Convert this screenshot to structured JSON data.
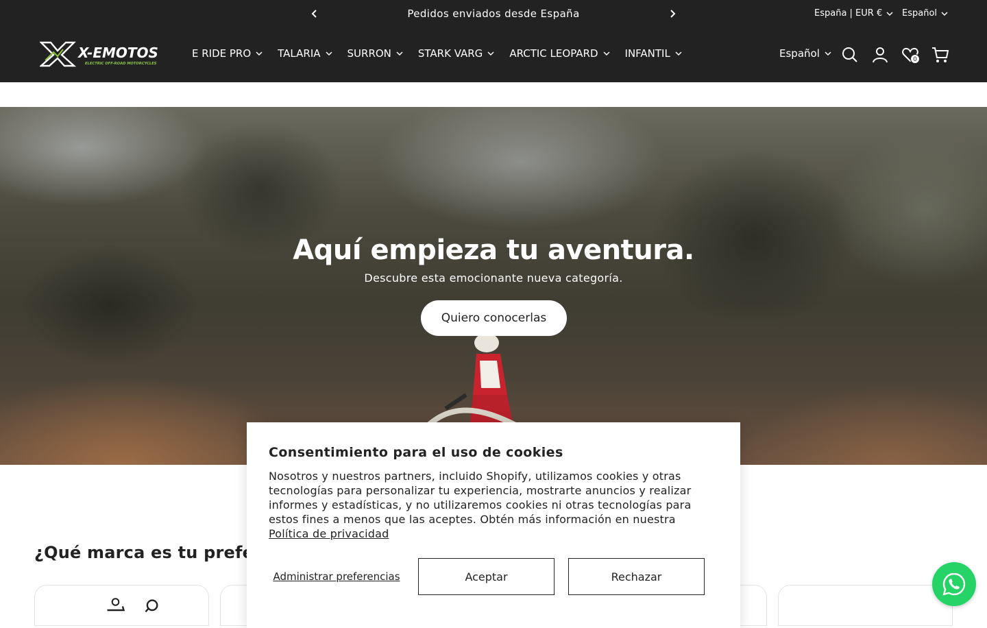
{
  "announcement": {
    "message": "Pedidos enviados desde España",
    "prev_icon": "chevron-left-icon",
    "next_icon": "chevron-right-icon",
    "country_selector": "España | EUR €",
    "language_selector": "Español"
  },
  "header": {
    "logo_text": "X-EMOTOS",
    "logo_tagline": "ELECTRIC OFF-ROAD MOTORCYCLES",
    "nav": [
      {
        "label": "E RIDE PRO"
      },
      {
        "label": "TALARIA"
      },
      {
        "label": "SURRON"
      },
      {
        "label": "STARK VARG"
      },
      {
        "label": "ARCTIC LEOPARD"
      },
      {
        "label": "INFANTIL"
      }
    ],
    "language": "Español",
    "wishlist_count": "0",
    "icons": [
      "search-icon",
      "account-icon",
      "wishlist-icon",
      "cart-icon"
    ]
  },
  "hero": {
    "title": "Aquí empieza tu aventura.",
    "subtitle": "Descubre esta emocionante nueva categoría.",
    "button": "Quiero conocerlas"
  },
  "brands": {
    "title": "¿Qué marca es tu preferida?"
  },
  "cookie": {
    "title": "Consentimiento para el uso de cookies",
    "body": "Nosotros y nuestros partners, incluido Shopify, utilizamos cookies y otras tecnologías para personalizar tu experiencia, mostrarte anuncios y realizar informes y estadísticas, y no utilizaremos cookies ni otras tecnologías para estos fines a menos que las aceptes. Obtén más información en nuestra ",
    "link": "Política de privacidad",
    "manage": "Administrar preferencias",
    "accept": "Aceptar",
    "reject": "Rechazar"
  },
  "colors": {
    "header_bg": "#222222",
    "logo_accent": "#8cc63f",
    "whatsapp": "#25d366"
  }
}
